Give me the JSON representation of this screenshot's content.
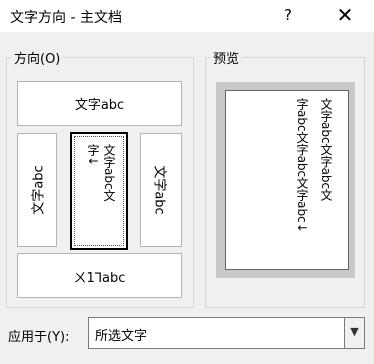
{
  "window": {
    "title": "文字方向 - 主文档",
    "help_label": "?",
    "close_label": "✕"
  },
  "direction_group": {
    "legend": "方向(O)",
    "options": {
      "horizontal": "文字abc",
      "vertical_left": "文字abc",
      "vertical_selected_col1": "文字abc文",
      "vertical_selected_col2": "字↓",
      "vertical_right": "文字abc",
      "horizontal_reversed": "ㄨ1⅂abc"
    }
  },
  "preview_group": {
    "legend": "预览",
    "col1": "文字abc文字abc文",
    "col2": "字abc文字abc文字abc↓"
  },
  "apply_to": {
    "label": "应用于(Y):",
    "value": "所选文字",
    "arrow_icon": "chevron-down-icon"
  }
}
